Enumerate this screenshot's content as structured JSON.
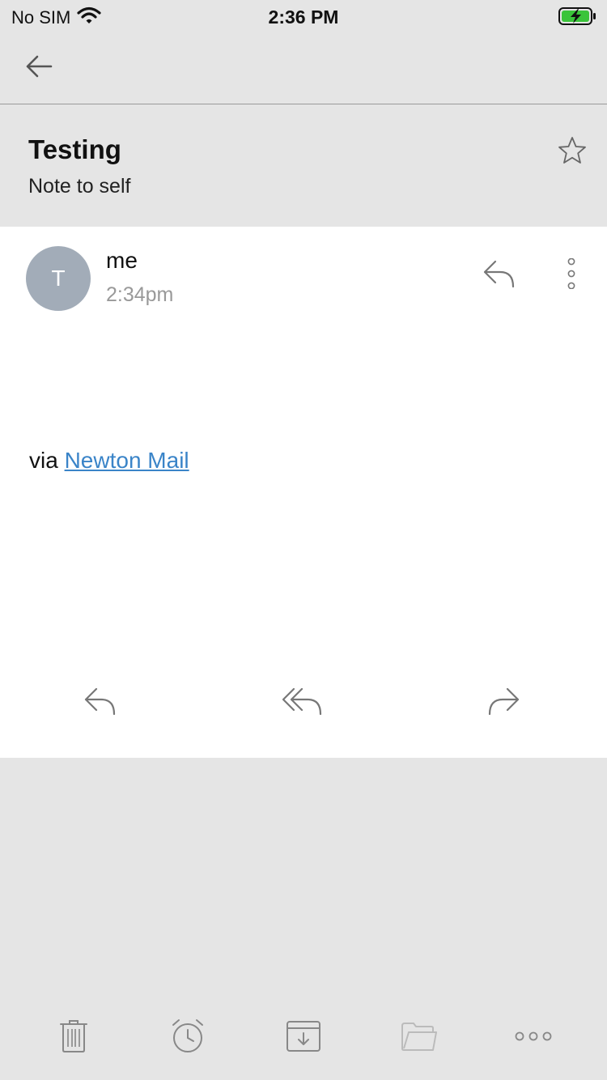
{
  "status_bar": {
    "carrier": "No SIM",
    "time": "2:36 PM",
    "battery_color": "#3ac43a"
  },
  "nav": {
    "back_icon": "arrow-left-icon"
  },
  "subject": {
    "title": "Testing",
    "subtitle": "Note to self",
    "star_icon": "star-outline-icon"
  },
  "message": {
    "avatar_initial": "T",
    "avatar_color": "#a2acb8",
    "sender": "me",
    "time": "2:34pm",
    "body_prefix": "via ",
    "body_link": "Newton Mail",
    "link_color": "#3a84c8"
  },
  "actions": {
    "reply_icon": "reply-icon",
    "reply_all_icon": "reply-all-icon",
    "forward_icon": "forward-icon"
  },
  "toolbar": {
    "items": [
      "trash-icon",
      "snooze-clock-icon",
      "archive-icon",
      "folder-icon",
      "more-horizontal-icon"
    ]
  }
}
